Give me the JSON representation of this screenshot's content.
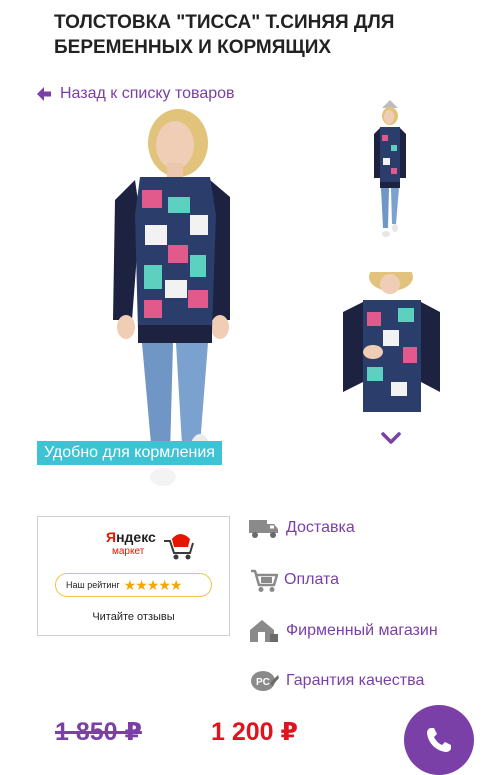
{
  "product": {
    "title": "ТОЛСТОВКА \"ТИССА\" Т.СИНЯЯ ДЛЯ БЕРЕМЕННЫХ И КОРМЯЩИХ"
  },
  "nav": {
    "back_label": "Назад к списку товаров"
  },
  "gallery": {
    "badge": "Удобно для кормления",
    "thumbnails": [
      "thumbnail-full",
      "thumbnail-nursing"
    ]
  },
  "yandex_market": {
    "logo_prefix": "Я",
    "logo_rest": "ндекс",
    "logo_sub": "маркет",
    "rating_label": "Наш рейтинг",
    "stars": "★★★★★",
    "rating_value": 5,
    "reviews_link": "Читайте отзывы"
  },
  "info": {
    "delivery": "Доставка",
    "payment": "Оплата",
    "store": "Фирменный магазин",
    "warranty": "Гарантия качества"
  },
  "prices": {
    "old": "1 850 ₽",
    "new": "1 200 ₽"
  },
  "colors": {
    "accent": "#7b3fa8",
    "badge": "#3ec3d5",
    "price_new": "#e0141e",
    "star": "#f7a500"
  }
}
